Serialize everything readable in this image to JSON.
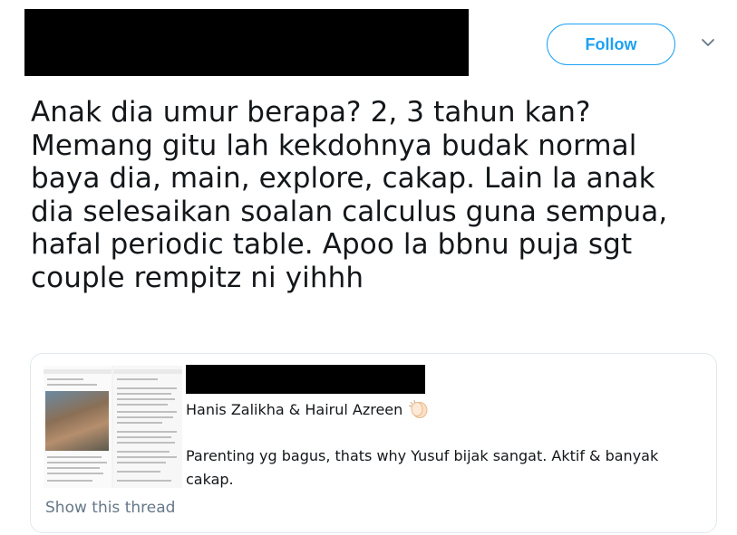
{
  "header": {
    "follow_label": "Follow",
    "menu_icon": "chevron-down-icon",
    "accent_color": "#1da1f2"
  },
  "tweet": {
    "lines": [
      "Anak dia umur berapa? 2, 3 tahun kan?",
      "Memang gitu lah kekdohnya budak normal",
      "baya dia, main, explore, cakap. Lain la anak",
      "dia selesaikan soalan calculus guna sempua,",
      "hafal periodic table. Apoo la bbnu puja sgt",
      "couple rempitz ni yihhh"
    ]
  },
  "quoted_tweet": {
    "author": "Hanis Zalikha & Hairul Azreen",
    "author_emoji": "clapping-hands-icon",
    "text": "Parenting yg bagus, thats why Yusuf bijak sangat. Aktif & banyak cakap.",
    "show_thread_label": "Show this thread"
  }
}
